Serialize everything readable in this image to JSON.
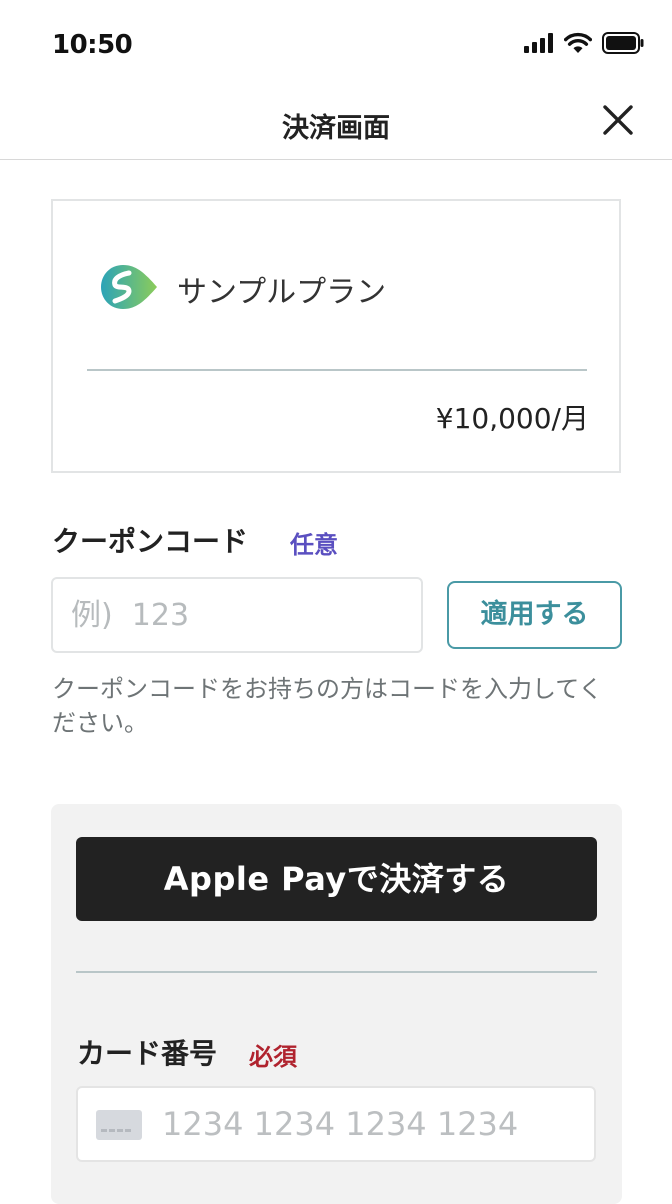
{
  "status_bar": {
    "time": "10:50"
  },
  "header": {
    "title": "決済画面"
  },
  "plan": {
    "name": "サンプルプラン",
    "price": "¥10,000/月"
  },
  "coupon": {
    "label": "クーポンコード",
    "optional_badge": "任意",
    "placeholder": "例)  123",
    "apply_label": "適用する",
    "help_text": "クーポンコードをお持ちの方はコードを入力してください。"
  },
  "payment": {
    "applepay_label": "Apple Payで決済する",
    "card_label": "カード番号",
    "required_badge": "必須",
    "card_placeholder": "1234 1234 1234 1234"
  },
  "colors": {
    "accent": "#3c8f9c",
    "optional": "#5a4fc0",
    "required": "#b0232e",
    "applepay_bg": "#222222"
  }
}
